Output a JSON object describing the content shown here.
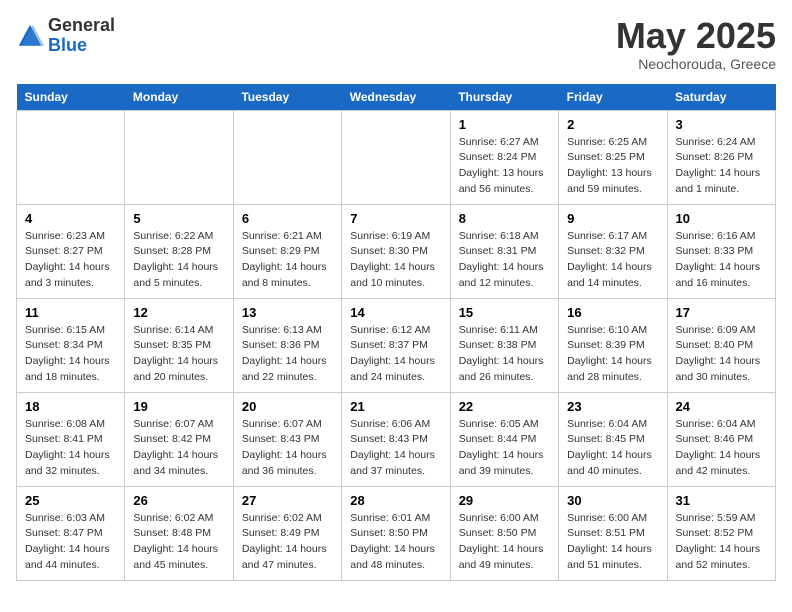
{
  "header": {
    "logo_general": "General",
    "logo_blue": "Blue",
    "title": "May 2025",
    "subtitle": "Neochorouda, Greece"
  },
  "days_of_week": [
    "Sunday",
    "Monday",
    "Tuesday",
    "Wednesday",
    "Thursday",
    "Friday",
    "Saturday"
  ],
  "weeks": [
    [
      {
        "day": "",
        "info": ""
      },
      {
        "day": "",
        "info": ""
      },
      {
        "day": "",
        "info": ""
      },
      {
        "day": "",
        "info": ""
      },
      {
        "day": "1",
        "info": "Sunrise: 6:27 AM\nSunset: 8:24 PM\nDaylight: 13 hours and 56 minutes."
      },
      {
        "day": "2",
        "info": "Sunrise: 6:25 AM\nSunset: 8:25 PM\nDaylight: 13 hours and 59 minutes."
      },
      {
        "day": "3",
        "info": "Sunrise: 6:24 AM\nSunset: 8:26 PM\nDaylight: 14 hours and 1 minute."
      }
    ],
    [
      {
        "day": "4",
        "info": "Sunrise: 6:23 AM\nSunset: 8:27 PM\nDaylight: 14 hours and 3 minutes."
      },
      {
        "day": "5",
        "info": "Sunrise: 6:22 AM\nSunset: 8:28 PM\nDaylight: 14 hours and 5 minutes."
      },
      {
        "day": "6",
        "info": "Sunrise: 6:21 AM\nSunset: 8:29 PM\nDaylight: 14 hours and 8 minutes."
      },
      {
        "day": "7",
        "info": "Sunrise: 6:19 AM\nSunset: 8:30 PM\nDaylight: 14 hours and 10 minutes."
      },
      {
        "day": "8",
        "info": "Sunrise: 6:18 AM\nSunset: 8:31 PM\nDaylight: 14 hours and 12 minutes."
      },
      {
        "day": "9",
        "info": "Sunrise: 6:17 AM\nSunset: 8:32 PM\nDaylight: 14 hours and 14 minutes."
      },
      {
        "day": "10",
        "info": "Sunrise: 6:16 AM\nSunset: 8:33 PM\nDaylight: 14 hours and 16 minutes."
      }
    ],
    [
      {
        "day": "11",
        "info": "Sunrise: 6:15 AM\nSunset: 8:34 PM\nDaylight: 14 hours and 18 minutes."
      },
      {
        "day": "12",
        "info": "Sunrise: 6:14 AM\nSunset: 8:35 PM\nDaylight: 14 hours and 20 minutes."
      },
      {
        "day": "13",
        "info": "Sunrise: 6:13 AM\nSunset: 8:36 PM\nDaylight: 14 hours and 22 minutes."
      },
      {
        "day": "14",
        "info": "Sunrise: 6:12 AM\nSunset: 8:37 PM\nDaylight: 14 hours and 24 minutes."
      },
      {
        "day": "15",
        "info": "Sunrise: 6:11 AM\nSunset: 8:38 PM\nDaylight: 14 hours and 26 minutes."
      },
      {
        "day": "16",
        "info": "Sunrise: 6:10 AM\nSunset: 8:39 PM\nDaylight: 14 hours and 28 minutes."
      },
      {
        "day": "17",
        "info": "Sunrise: 6:09 AM\nSunset: 8:40 PM\nDaylight: 14 hours and 30 minutes."
      }
    ],
    [
      {
        "day": "18",
        "info": "Sunrise: 6:08 AM\nSunset: 8:41 PM\nDaylight: 14 hours and 32 minutes."
      },
      {
        "day": "19",
        "info": "Sunrise: 6:07 AM\nSunset: 8:42 PM\nDaylight: 14 hours and 34 minutes."
      },
      {
        "day": "20",
        "info": "Sunrise: 6:07 AM\nSunset: 8:43 PM\nDaylight: 14 hours and 36 minutes."
      },
      {
        "day": "21",
        "info": "Sunrise: 6:06 AM\nSunset: 8:43 PM\nDaylight: 14 hours and 37 minutes."
      },
      {
        "day": "22",
        "info": "Sunrise: 6:05 AM\nSunset: 8:44 PM\nDaylight: 14 hours and 39 minutes."
      },
      {
        "day": "23",
        "info": "Sunrise: 6:04 AM\nSunset: 8:45 PM\nDaylight: 14 hours and 40 minutes."
      },
      {
        "day": "24",
        "info": "Sunrise: 6:04 AM\nSunset: 8:46 PM\nDaylight: 14 hours and 42 minutes."
      }
    ],
    [
      {
        "day": "25",
        "info": "Sunrise: 6:03 AM\nSunset: 8:47 PM\nDaylight: 14 hours and 44 minutes."
      },
      {
        "day": "26",
        "info": "Sunrise: 6:02 AM\nSunset: 8:48 PM\nDaylight: 14 hours and 45 minutes."
      },
      {
        "day": "27",
        "info": "Sunrise: 6:02 AM\nSunset: 8:49 PM\nDaylight: 14 hours and 47 minutes."
      },
      {
        "day": "28",
        "info": "Sunrise: 6:01 AM\nSunset: 8:50 PM\nDaylight: 14 hours and 48 minutes."
      },
      {
        "day": "29",
        "info": "Sunrise: 6:00 AM\nSunset: 8:50 PM\nDaylight: 14 hours and 49 minutes."
      },
      {
        "day": "30",
        "info": "Sunrise: 6:00 AM\nSunset: 8:51 PM\nDaylight: 14 hours and 51 minutes."
      },
      {
        "day": "31",
        "info": "Sunrise: 5:59 AM\nSunset: 8:52 PM\nDaylight: 14 hours and 52 minutes."
      }
    ]
  ]
}
